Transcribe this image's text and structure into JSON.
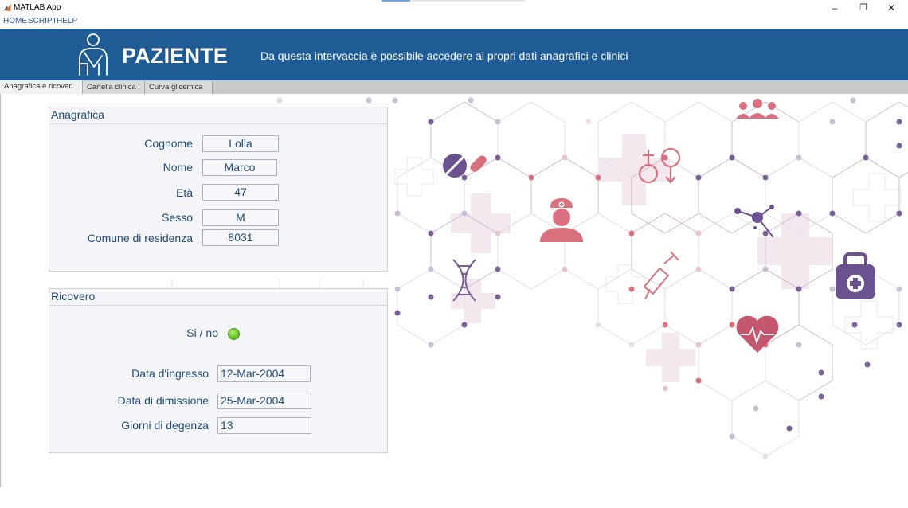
{
  "window": {
    "title": "MATLAB App",
    "controls": {
      "minimize": "–",
      "restore": "❐",
      "close": "✕"
    }
  },
  "menu": [
    "HOME",
    "SCRIPT",
    "HELP"
  ],
  "header": {
    "title": "PAZIENTE",
    "subtitle": "Da questa intervaccia è possibile accedere ai propri dati anagrafici e clinici",
    "background_color": "#1f5b95"
  },
  "tabs": [
    {
      "label": "Anagrafica e ricoveri",
      "active": true
    },
    {
      "label": "Cartella clinica",
      "active": false
    },
    {
      "label": "Curva glicemica",
      "active": false
    }
  ],
  "anagrafica": {
    "title": "Anagrafica",
    "fields": [
      {
        "label": "Cognome",
        "value": "Lolla"
      },
      {
        "label": "Nome",
        "value": "Marco"
      },
      {
        "label": "Età",
        "value": "47"
      },
      {
        "label": "Sesso",
        "value": "M"
      },
      {
        "label": "Comune di residenza",
        "value": "8031"
      }
    ]
  },
  "ricovero": {
    "title": "Ricovero",
    "si_no_label": "Si / no",
    "lamp_color": "#5fc61c",
    "fields": [
      {
        "label": "Data d'ingresso",
        "value": "12-Mar-2004"
      },
      {
        "label": "Data di dimissione",
        "value": "25-Mar-2004"
      },
      {
        "label": "Giorni di degenza",
        "value": "13"
      }
    ]
  },
  "background_icons": [
    "pills-icon",
    "gender-symbols-icon",
    "medical-staff-icon",
    "nurse-icon",
    "molecule-icon",
    "dna-icon",
    "syringe-icon",
    "first-aid-kit-icon",
    "heart-ecg-icon"
  ],
  "colors": {
    "label_text": "#1f4e79",
    "icon_pink": "#d9707e",
    "icon_purple": "#6c5190",
    "node_dot": "#6a4f8e"
  }
}
